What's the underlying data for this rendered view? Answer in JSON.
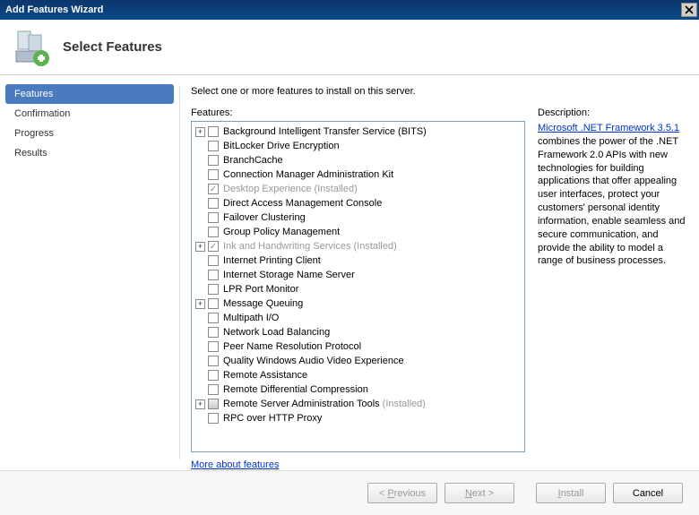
{
  "window": {
    "title": "Add Features Wizard"
  },
  "header": {
    "title": "Select Features"
  },
  "sidebar": {
    "items": [
      {
        "label": "Features",
        "active": true
      },
      {
        "label": "Confirmation",
        "active": false
      },
      {
        "label": "Progress",
        "active": false
      },
      {
        "label": "Results",
        "active": false
      }
    ]
  },
  "main": {
    "instruction": "Select one or more features to install on this server.",
    "features_label": "Features:",
    "more_link": "More about features",
    "tree": [
      {
        "label": "Background Intelligent Transfer Service (BITS)",
        "expandable": true,
        "installed": false,
        "checked": false
      },
      {
        "label": "BitLocker Drive Encryption",
        "expandable": false,
        "installed": false,
        "checked": false
      },
      {
        "label": "BranchCache",
        "expandable": false,
        "installed": false,
        "checked": false
      },
      {
        "label": "Connection Manager Administration Kit",
        "expandable": false,
        "installed": false,
        "checked": false
      },
      {
        "label": "Desktop Experience",
        "expandable": false,
        "installed": true,
        "checked": true
      },
      {
        "label": "Direct Access Management Console",
        "expandable": false,
        "installed": false,
        "checked": false
      },
      {
        "label": "Failover Clustering",
        "expandable": false,
        "installed": false,
        "checked": false
      },
      {
        "label": "Group Policy Management",
        "expandable": false,
        "installed": false,
        "checked": false
      },
      {
        "label": "Ink and Handwriting Services",
        "expandable": true,
        "installed": true,
        "checked": true
      },
      {
        "label": "Internet Printing Client",
        "expandable": false,
        "installed": false,
        "checked": false
      },
      {
        "label": "Internet Storage Name Server",
        "expandable": false,
        "installed": false,
        "checked": false
      },
      {
        "label": "LPR Port Monitor",
        "expandable": false,
        "installed": false,
        "checked": false
      },
      {
        "label": "Message Queuing",
        "expandable": true,
        "installed": false,
        "checked": false
      },
      {
        "label": "Multipath I/O",
        "expandable": false,
        "installed": false,
        "checked": false
      },
      {
        "label": "Network Load Balancing",
        "expandable": false,
        "installed": false,
        "checked": false
      },
      {
        "label": "Peer Name Resolution Protocol",
        "expandable": false,
        "installed": false,
        "checked": false
      },
      {
        "label": "Quality Windows Audio Video Experience",
        "expandable": false,
        "installed": false,
        "checked": false
      },
      {
        "label": "Remote Assistance",
        "expandable": false,
        "installed": false,
        "checked": false
      },
      {
        "label": "Remote Differential Compression",
        "expandable": false,
        "installed": false,
        "checked": false
      },
      {
        "label": "Remote Server Administration Tools",
        "expandable": true,
        "installed": true,
        "checked": false,
        "partial": true
      },
      {
        "label": "RPC over HTTP Proxy",
        "expandable": false,
        "installed": false,
        "checked": false
      }
    ],
    "installed_suffix": "(Installed)"
  },
  "description": {
    "label": "Description:",
    "link_text": "Microsoft .NET Framework 3.5.1",
    "body": " combines the power of the .NET Framework 2.0 APIs with new technologies for building applications that offer appealing user interfaces, protect your customers' personal identity information, enable seamless and secure communication, and provide the ability to model a range of business processes."
  },
  "footer": {
    "previous": "< Previous",
    "next": "Next >",
    "install": "Install",
    "cancel": "Cancel",
    "previous_enabled": false,
    "next_enabled": false,
    "install_enabled": false,
    "cancel_enabled": true
  }
}
